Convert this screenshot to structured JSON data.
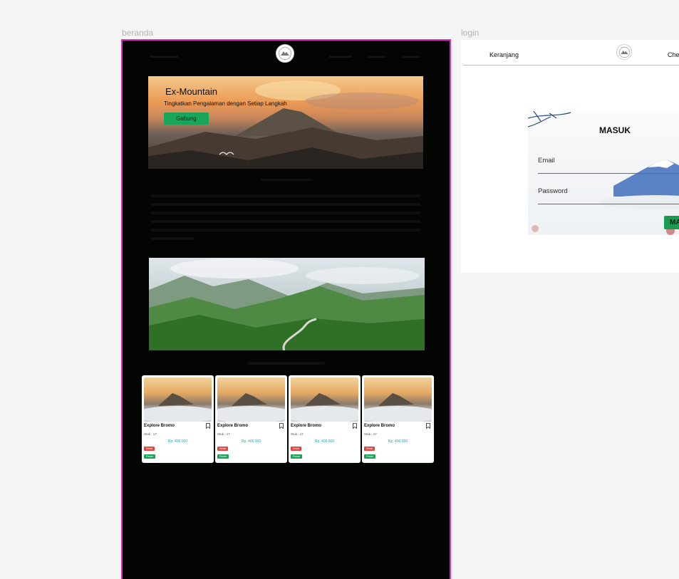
{
  "canvas": {
    "frames": [
      {
        "label": "beranda"
      },
      {
        "label": "login"
      }
    ]
  },
  "beranda": {
    "hero": {
      "title": "Ex-Mountain",
      "subtitle": "Tingkatkan Pengalaman dengan Setiap Langkah",
      "button_label": "Gabung"
    },
    "package_cards": [
      {
        "title": "Explore Bromo",
        "stock": "Stok : 17",
        "price": "Rp. 400.000",
        "detail_label": "Detail",
        "order_label": "Pesan"
      },
      {
        "title": "Explore Bromo",
        "stock": "Stok : 17",
        "price": "Rp. 400.000",
        "detail_label": "Detail",
        "order_label": "Pesan"
      },
      {
        "title": "Explore Bromo",
        "stock": "Stok : 17",
        "price": "Rp. 400.000",
        "detail_label": "Detail",
        "order_label": "Pesan"
      },
      {
        "title": "Explore Bromo",
        "stock": "Stok : 17",
        "price": "Rp. 400.000",
        "detail_label": "Detail",
        "order_label": "Pesan"
      }
    ]
  },
  "login": {
    "nav": {
      "cart": "Keranjang",
      "checkout": "Che"
    },
    "title": "MASUK",
    "email_label": "Email",
    "password_label": "Password",
    "submit_label": "MA"
  },
  "colors": {
    "frame_highlight": "#e32bc8",
    "dark_background": "#030502",
    "accent_green": "#18a65b",
    "price_teal": "#1aa6b7",
    "detail_red": "#e0453e"
  }
}
